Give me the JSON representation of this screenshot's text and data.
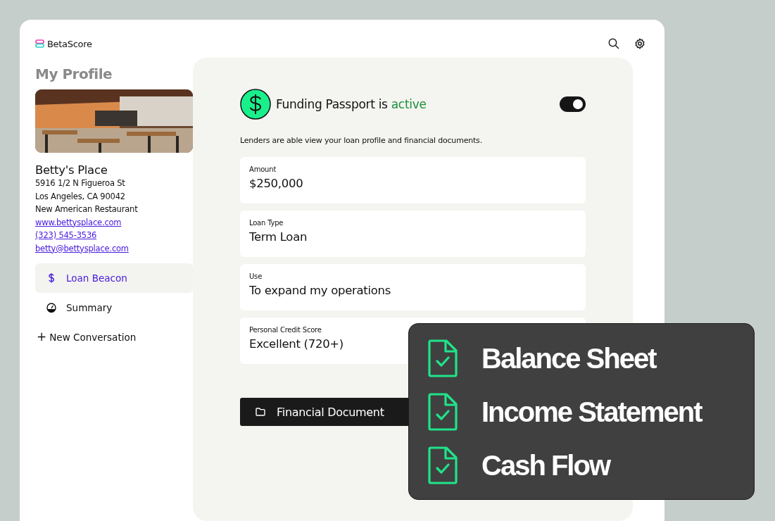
{
  "brand": {
    "name": "BetaScore"
  },
  "profile": {
    "heading": "My Profile",
    "picture": {
      "kind": "picture"
    },
    "business_name": "Betty's Place",
    "details": [
      "5916 1/2 N Figueroa St",
      "Los Angeles, CA 90042",
      "New American Restaurant"
    ],
    "links": [
      "www.bettysplace.com",
      "(323) 545-3536",
      "betty@bettysplace.com"
    ]
  },
  "nav": [
    {
      "label": "Loan Beacon",
      "kind": "dollar",
      "selected": true
    },
    {
      "label": "Summary",
      "kind": "gauge",
      "selected": false
    }
  ],
  "new_conversation": {
    "icon": "+",
    "label": "New Conversation"
  },
  "passport": {
    "title": "Funding Passport is",
    "status": "active",
    "on": true,
    "description": "Lenders are able view your loan profile and financial documents."
  },
  "fields": [
    {
      "label": "Amount",
      "value": "$250,000"
    },
    {
      "label": "Loan Type",
      "value": "Term Loan"
    },
    {
      "label": "Use",
      "value": "To expand my operations"
    },
    {
      "label": "Personal Credit Score",
      "value": "Excellent (720+)"
    }
  ],
  "documents_button": {
    "label": "Financial Document"
  },
  "documents_overlay": {
    "items": [
      {
        "label": "Balance Sheet",
        "checked": true
      },
      {
        "label": "Income Statement",
        "checked": true
      },
      {
        "label": "Cash Flow",
        "checked": true
      }
    ]
  }
}
